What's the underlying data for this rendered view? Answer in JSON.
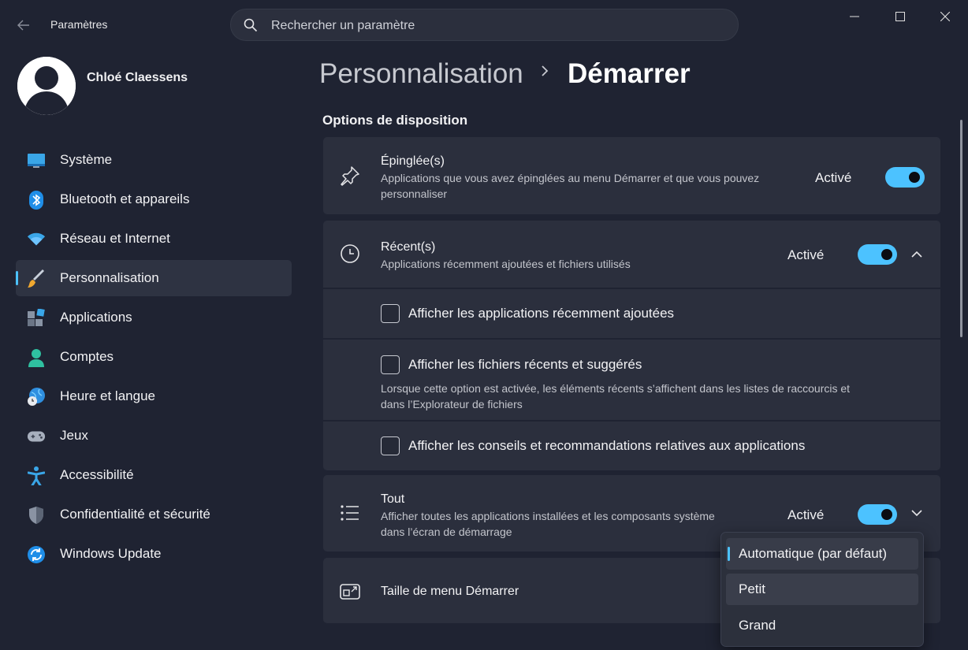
{
  "window": {
    "title": "Paramètres",
    "search_placeholder": "Rechercher un paramètre"
  },
  "user": {
    "name": "Chloé Claessens"
  },
  "sidebar": {
    "items": [
      {
        "label": "Système",
        "icon": "system-icon"
      },
      {
        "label": "Bluetooth et appareils",
        "icon": "bluetooth-icon"
      },
      {
        "label": "Réseau et Internet",
        "icon": "wifi-icon"
      },
      {
        "label": "Personnalisation",
        "icon": "brush-icon",
        "active": true
      },
      {
        "label": "Applications",
        "icon": "apps-icon"
      },
      {
        "label": "Comptes",
        "icon": "account-icon"
      },
      {
        "label": "Heure et langue",
        "icon": "globe-clock-icon"
      },
      {
        "label": "Jeux",
        "icon": "gamepad-icon"
      },
      {
        "label": "Accessibilité",
        "icon": "accessibility-icon"
      },
      {
        "label": "Confidentialité et sécurité",
        "icon": "shield-icon"
      },
      {
        "label": "Windows Update",
        "icon": "update-icon"
      }
    ]
  },
  "breadcrumb": {
    "parent": "Personnalisation",
    "current": "Démarrer"
  },
  "section": {
    "title": "Options de disposition"
  },
  "settings": {
    "pinned": {
      "title": "Épinglée(s)",
      "desc_line1": "Applications que vous avez épinglées au menu Démarrer et que vous pouvez",
      "desc_line2": "personnaliser",
      "status": "Activé"
    },
    "recent": {
      "title": "Récent(s)",
      "desc": "Applications récemment ajoutées et fichiers utilisés",
      "status": "Activé",
      "options": {
        "recent_apps": "Afficher les applications récemment ajoutées",
        "recent_files": "Afficher les fichiers récents et suggérés",
        "recent_files_desc_line1": "Lorsque cette option est activée, les éléments récents s’affichent dans les listes de raccourcis et",
        "recent_files_desc_line2": "dans l’Explorateur de fichiers",
        "tips": "Afficher les conseils et recommandations relatives aux applications"
      }
    },
    "all": {
      "title": "Tout",
      "desc_line1": "Afficher toutes les applications installées et les composants système",
      "desc_line2": "dans l’écran de démarrage",
      "status": "Activé"
    },
    "size": {
      "title": "Taille de menu Démarrer"
    }
  },
  "dropdown": {
    "options": [
      "Automatique (par défaut)",
      "Petit",
      "Grand"
    ],
    "selected": "Automatique (par défaut)"
  },
  "colors": {
    "accent": "#4cc2ff",
    "background": "#1f2332",
    "card": "#2b2f3d"
  }
}
